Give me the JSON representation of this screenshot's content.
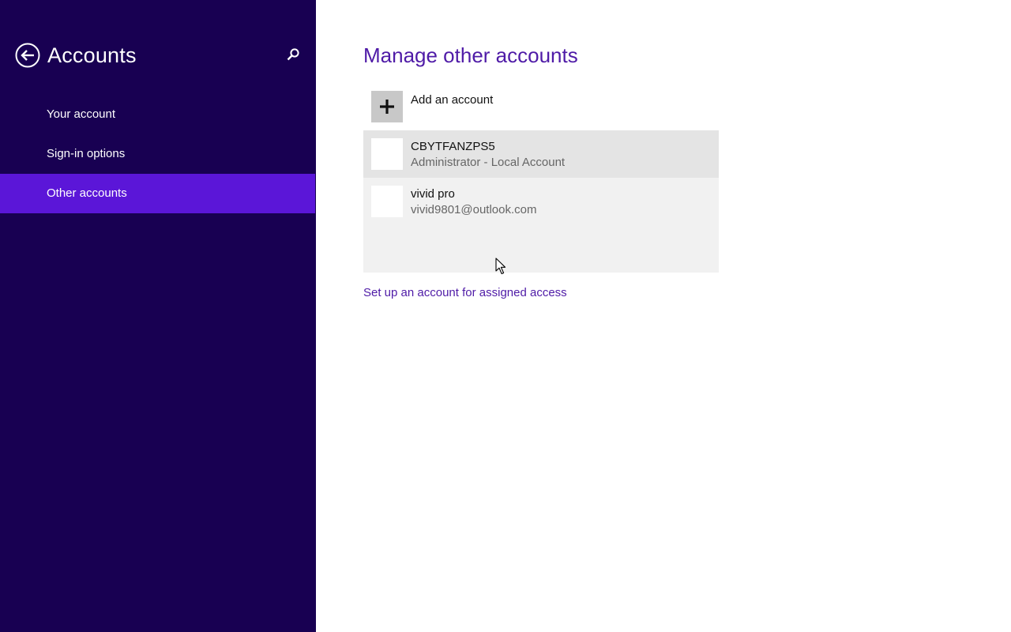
{
  "colors": {
    "sidebar_bg": "#180052",
    "nav_active_bg": "#5b16d8",
    "accent": "#4f1ba7",
    "list_bg": "#f1f1f1",
    "row_selected_bg": "#e4e4e4"
  },
  "sidebar": {
    "title": "Accounts",
    "back_icon": "back-arrow-icon",
    "search_icon": "search-icon",
    "items": [
      {
        "label": "Your account",
        "active": false
      },
      {
        "label": "Sign-in options",
        "active": false
      },
      {
        "label": "Other accounts",
        "active": true
      }
    ]
  },
  "main": {
    "title": "Manage other accounts",
    "add_account_label": "Add an account",
    "add_icon": "plus-icon",
    "accounts": [
      {
        "name": "CBYTFANZPS5",
        "detail": "Administrator - Local Account",
        "selected": true
      },
      {
        "name": "vivid pro",
        "detail": "vivid9801@outlook.com",
        "selected": false
      }
    ],
    "assigned_access_link": "Set up an account for assigned access"
  }
}
